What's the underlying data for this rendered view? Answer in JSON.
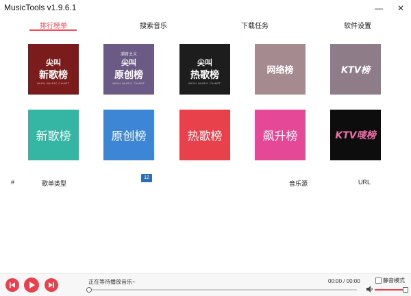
{
  "window": {
    "title": "MusicTools v1.9.6.1",
    "minimize_glyph": "—",
    "close_glyph": "✕"
  },
  "tabs": [
    {
      "label": "排行榜单",
      "active": true
    },
    {
      "label": "搜索音乐",
      "active": false
    },
    {
      "label": "下载任务",
      "active": false
    },
    {
      "label": "软件设置",
      "active": false
    }
  ],
  "accent_color": "#f54a5a",
  "charts": [
    {
      "top_text": "",
      "label": "尖叫\n新歌榜",
      "sub": "MIGU MUSIC CHART",
      "bg": "#7a1c1c",
      "style": "two-line"
    },
    {
      "top_text": "潮音主义",
      "label": "尖叫\n原创榜",
      "sub": "MIGU MUSIC CHART",
      "bg": "#6b5a86",
      "style": "two-line"
    },
    {
      "top_text": "",
      "label": "尖叫\n热歌榜",
      "sub": "MIGU MUSIC CHART",
      "bg": "#1d1d1d",
      "style": "two-line"
    },
    {
      "top_text": "",
      "label": "网络榜",
      "sub": "",
      "bg": "#a58a90",
      "style": "small"
    },
    {
      "top_text": "",
      "label": "KTV榜",
      "sub": "",
      "bg": "#8e7d88",
      "style": "small"
    },
    {
      "top_text": "",
      "label": "新歌榜",
      "sub": "",
      "bg": "#35b6a4",
      "style": "big"
    },
    {
      "top_text": "",
      "label": "原创榜",
      "sub": "",
      "bg": "#3d86d6",
      "style": "big"
    },
    {
      "top_text": "",
      "label": "热歌榜",
      "sub": "",
      "bg": "#e8414b",
      "style": "big"
    },
    {
      "top_text": "",
      "label": "飙升榜",
      "sub": "",
      "bg": "#e54896",
      "style": "big"
    },
    {
      "top_text": "",
      "label": "KTV唛榜",
      "sub": "",
      "bg": "#0d0d0d",
      "style": "ktv"
    }
  ],
  "table": {
    "col_index": "#",
    "col_type": "歌单类型",
    "col_source": "音乐源",
    "col_url": "URL"
  },
  "floating_badge": "12",
  "player": {
    "status": "正在等待播放音乐~",
    "time": "00:00 / 00:00",
    "mute_label": "静音模式",
    "progress": 0,
    "volume": 1.0
  }
}
